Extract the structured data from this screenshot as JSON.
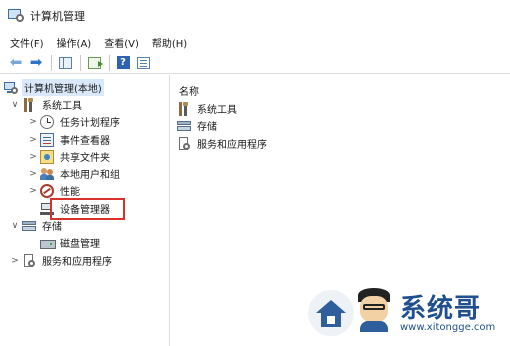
{
  "window": {
    "title": "计算机管理"
  },
  "menubar": {
    "items": [
      "文件(F)",
      "操作(A)",
      "查看(V)",
      "帮助(H)"
    ]
  },
  "tree": {
    "root": "计算机管理(本地)",
    "system_tools": {
      "label": "系统工具",
      "children": [
        "任务计划程序",
        "事件查看器",
        "共享文件夹",
        "本地用户和组",
        "性能",
        "设备管理器"
      ]
    },
    "storage": {
      "label": "存储",
      "children": [
        "磁盘管理"
      ]
    },
    "services": {
      "label": "服务和应用程序"
    }
  },
  "content": {
    "column_header": "名称",
    "items": [
      "系统工具",
      "存储",
      "服务和应用程序"
    ]
  },
  "watermark": {
    "brand": "系统哥",
    "url": "www.xitongge.com"
  },
  "colors": {
    "highlight": "#d9322b",
    "accent": "#2e73c8",
    "selection": "#d9e8fb"
  }
}
